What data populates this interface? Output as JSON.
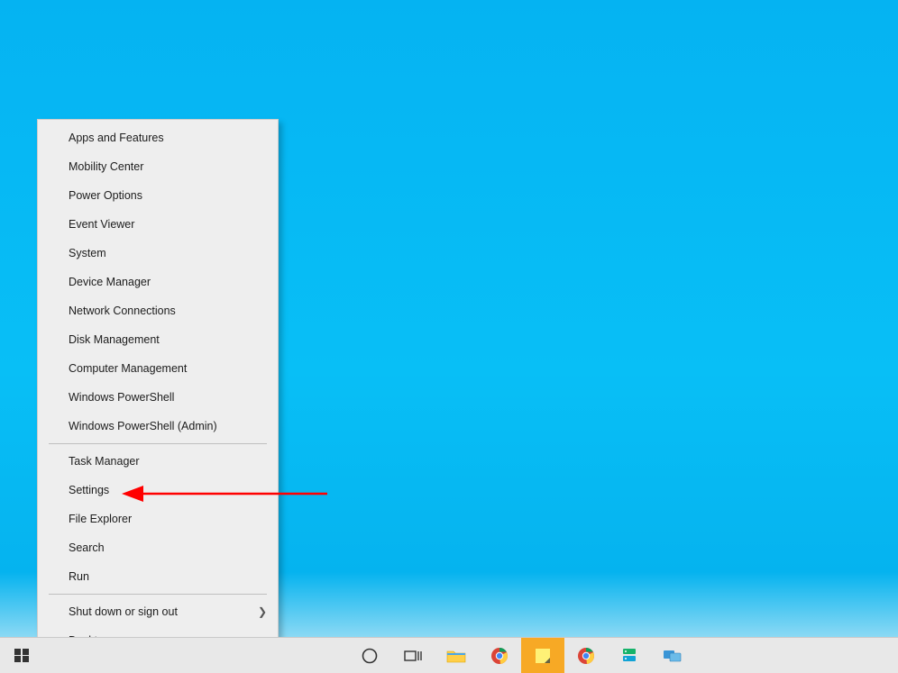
{
  "context_menu": {
    "groups": [
      [
        "Apps and Features",
        "Mobility Center",
        "Power Options",
        "Event Viewer",
        "System",
        "Device Manager",
        "Network Connections",
        "Disk Management",
        "Computer Management",
        "Windows PowerShell",
        "Windows PowerShell (Admin)"
      ],
      [
        "Task Manager",
        "Settings",
        "File Explorer",
        "Search",
        "Run"
      ],
      [
        {
          "label": "Shut down or sign out",
          "submenu": true
        },
        "Desktop"
      ]
    ]
  },
  "annotation": {
    "target_label": "Settings",
    "color": "#ff0000"
  },
  "taskbar": {
    "items": [
      {
        "name": "start-button",
        "icon": "windows-logo"
      },
      {
        "name": "cortana-button",
        "icon": "circle-outline"
      },
      {
        "name": "task-view-button",
        "icon": "task-view"
      },
      {
        "name": "file-explorer-button",
        "icon": "folder"
      },
      {
        "name": "chrome-button",
        "icon": "chrome"
      },
      {
        "name": "sticky-notes-button",
        "icon": "sticky-note",
        "active": true
      },
      {
        "name": "chrome-button-2",
        "icon": "chrome"
      },
      {
        "name": "server-manager-button",
        "icon": "server"
      },
      {
        "name": "remote-desktop-button",
        "icon": "monitors"
      }
    ]
  }
}
